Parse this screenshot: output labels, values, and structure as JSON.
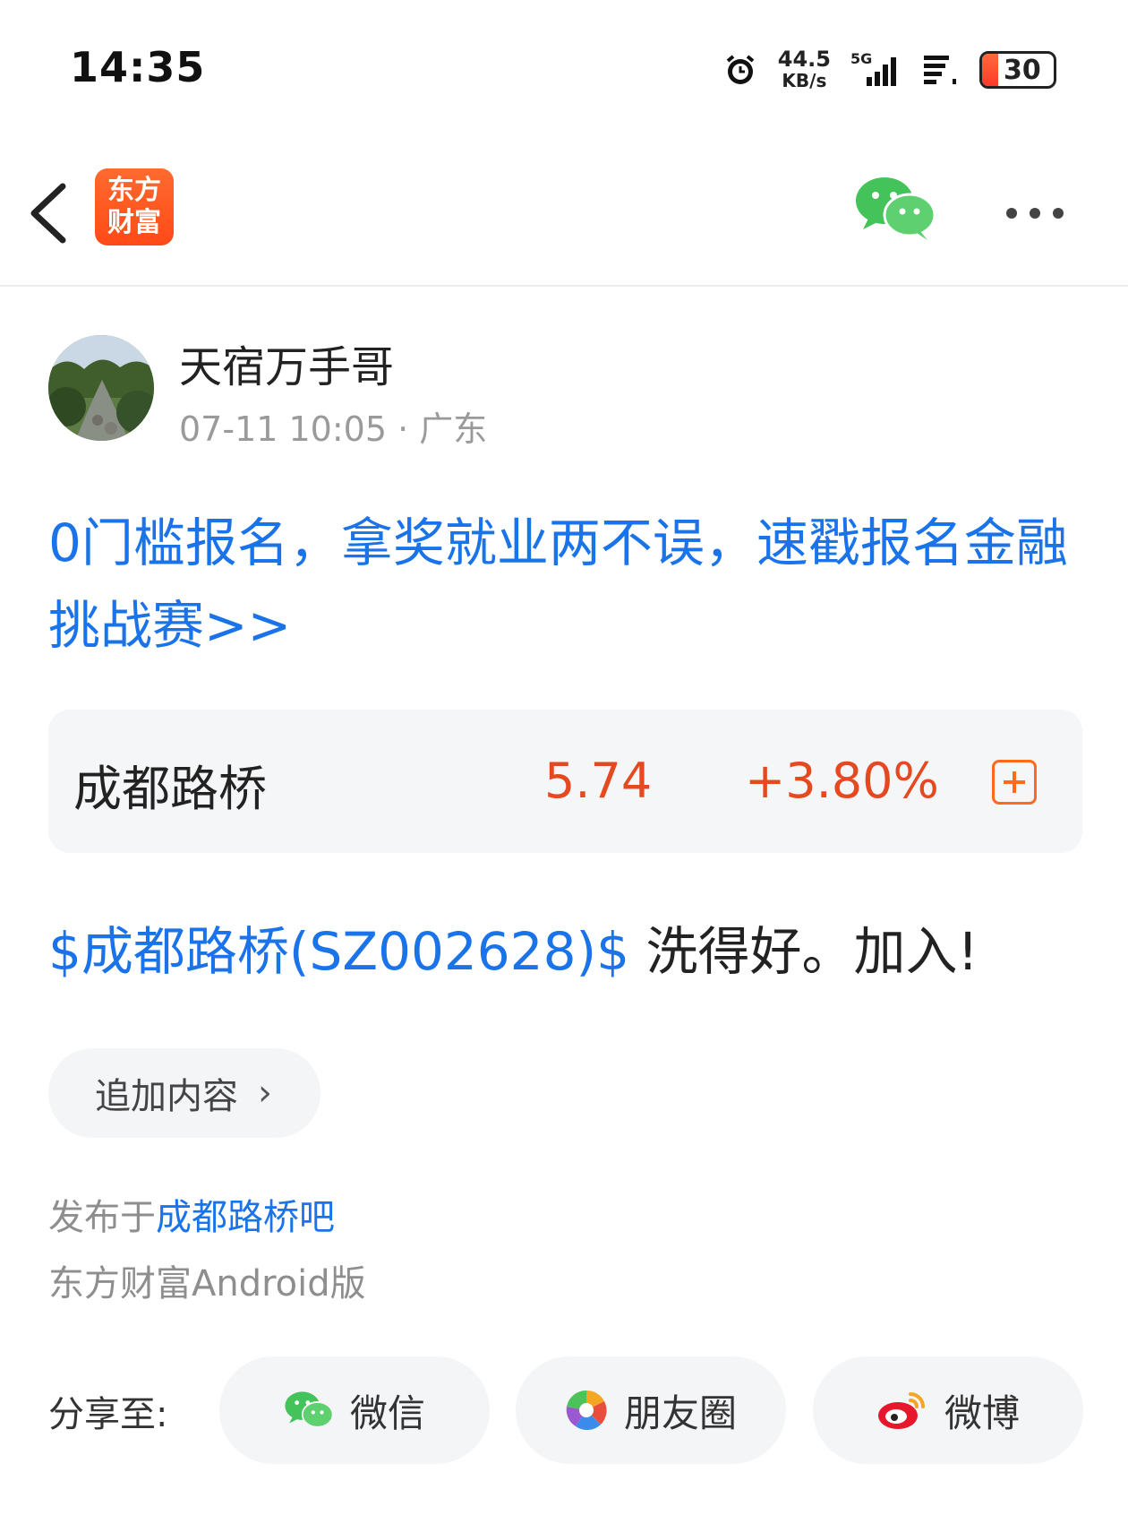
{
  "status_bar": {
    "time": "14:35",
    "net_speed_value": "44.5",
    "net_speed_unit": "KB/s",
    "network": "5G",
    "battery": "30"
  },
  "header": {
    "logo_line1": "东方",
    "logo_line2": "财富",
    "icons": [
      "back-arrow-icon",
      "wechat-icon",
      "more-icon"
    ]
  },
  "author": {
    "name": "天宿万手哥",
    "meta": "07-11 10:05 · 广东"
  },
  "promo": {
    "text": "0门槛报名，拿奖就业两不误，速戳报名金融挑战赛>>"
  },
  "stock_card": {
    "name": "成都路桥",
    "price": "5.74",
    "change": "+3.80%"
  },
  "post": {
    "tag": "$成都路桥(SZ002628)$",
    "text": " 洗得好。加入!"
  },
  "append_button": {
    "label": "追加内容",
    "chevron": "›"
  },
  "published": {
    "prefix": "发布于",
    "bar_link": "成都路桥吧",
    "client": "东方财富Android版"
  },
  "share": {
    "label": "分享至:",
    "targets": [
      {
        "label": "微信",
        "icon": "wechat-icon"
      },
      {
        "label": "朋友圈",
        "icon": "moments-icon"
      },
      {
        "label": "微博",
        "icon": "weibo-icon"
      }
    ]
  },
  "colors": {
    "link_blue": "#1a73e8",
    "stock_up": "#e4491f",
    "brand_orange": "#ff5a1f",
    "wechat_green": "#43c35a"
  }
}
